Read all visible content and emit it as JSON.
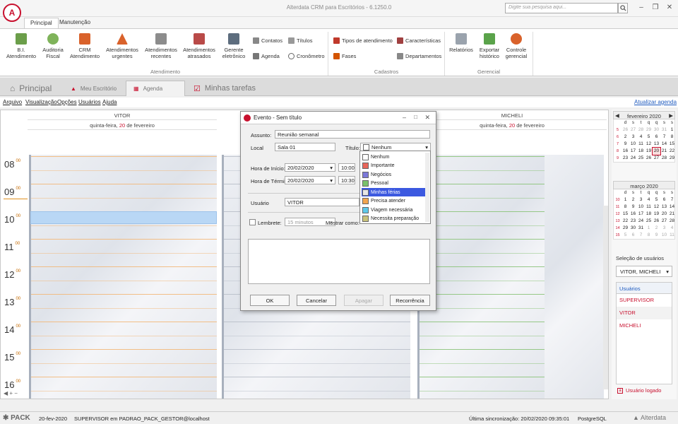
{
  "window": {
    "title": "Alterdata CRM para Escritórios - 6.1250.0",
    "search_placeholder": "Digite sua pesquisa aqui...",
    "logo_letter": "A"
  },
  "ribbon_tabs": [
    "Principal",
    "Manutenção"
  ],
  "ribbon": {
    "atendimento_buttons": [
      {
        "label": "B.I.\nAtendimento",
        "icon": "bi-icon"
      },
      {
        "label": "Auditoria\nFiscal",
        "icon": "audit-icon"
      },
      {
        "label": "CRM\nAtendimento",
        "icon": "crm-icon"
      },
      {
        "label": "Atendimentos\nurgentes",
        "icon": "urgent-icon"
      },
      {
        "label": "Atendimentos\nrecentes",
        "icon": "recent-icon"
      },
      {
        "label": "Atendimentos\natrasados",
        "icon": "late-icon"
      },
      {
        "label": "Gerente\neletrônico",
        "icon": "manager-icon"
      }
    ],
    "small_items": [
      "Contatos",
      "Agenda",
      "Títulos",
      "Cronômetro"
    ],
    "cadastros_items": [
      "Tipos de atendimento",
      "Fases",
      "Características",
      "Departamentos"
    ],
    "gerencial_buttons": [
      "Relatórios",
      "Exportar\nhistórico",
      "Controle\ngerencial"
    ],
    "groups": {
      "atendimento": "Atendimento",
      "cadastros": "Cadastros",
      "gerencial": "Gerencial"
    }
  },
  "doc_tabs": [
    "Principal",
    "Meu Escritório",
    "Agenda",
    "Minhas tarefas"
  ],
  "menu": [
    "Arquivo",
    "Visualização",
    "Opções",
    "Usuários",
    "Ajuda"
  ],
  "agenda_update": "Atualizar agenda",
  "calendar": {
    "columns": [
      {
        "user": "VITOR",
        "day_prefix": "quinta-feira, ",
        "day": "20",
        "day_suffix": " de fevereiro"
      },
      {
        "user": "",
        "day_prefix": "",
        "day": "",
        "day_suffix": ""
      },
      {
        "user": "MICHELI",
        "day_prefix": "quinta-feira, ",
        "day": "20",
        "day_suffix": " de fevereiro"
      }
    ],
    "hours": [
      "08",
      "09",
      "10",
      "11",
      "12",
      "13",
      "14",
      "15",
      "16"
    ],
    "minutes": "00"
  },
  "mini_calendars": [
    {
      "title": "fevereiro 2020",
      "weekdays": [
        "d",
        "s",
        "t",
        "q",
        "q",
        "s",
        "s"
      ],
      "weeks": [
        {
          "wk": "5",
          "days": [
            "26",
            "27",
            "28",
            "29",
            "30",
            "31",
            "1"
          ]
        },
        {
          "wk": "6",
          "days": [
            "2",
            "3",
            "4",
            "5",
            "6",
            "7",
            "8"
          ]
        },
        {
          "wk": "7",
          "days": [
            "9",
            "10",
            "11",
            "12",
            "13",
            "14",
            "15"
          ]
        },
        {
          "wk": "8",
          "days": [
            "16",
            "17",
            "18",
            "19",
            "20",
            "21",
            "22"
          ]
        },
        {
          "wk": "9",
          "days": [
            "23",
            "24",
            "25",
            "26",
            "27",
            "28",
            "29"
          ]
        }
      ]
    },
    {
      "title": "março 2020",
      "weekdays": [
        "d",
        "s",
        "t",
        "q",
        "q",
        "s",
        "s"
      ],
      "weeks": [
        {
          "wk": "10",
          "days": [
            "1",
            "2",
            "3",
            "4",
            "5",
            "6",
            "7"
          ]
        },
        {
          "wk": "11",
          "days": [
            "8",
            "9",
            "10",
            "11",
            "12",
            "13",
            "14"
          ]
        },
        {
          "wk": "12",
          "days": [
            "15",
            "16",
            "17",
            "18",
            "19",
            "20",
            "21"
          ]
        },
        {
          "wk": "13",
          "days": [
            "22",
            "23",
            "24",
            "25",
            "26",
            "27",
            "28"
          ]
        },
        {
          "wk": "14",
          "days": [
            "29",
            "30",
            "31",
            "1",
            "2",
            "3",
            "4"
          ]
        },
        {
          "wk": "15",
          "days": [
            "5",
            "6",
            "7",
            "8",
            "9",
            "10",
            "11"
          ]
        }
      ]
    }
  ],
  "user_selection": {
    "title": "Seleção de usuários",
    "value": "VITOR, MICHELI",
    "list_header": "Usuários",
    "users": [
      "SUPERVISOR",
      "VITOR",
      "MICHELI"
    ],
    "logged_label": "Usuário logado"
  },
  "dialog": {
    "title": "Evento - Sem título",
    "assunto_label": "Assunto:",
    "assunto": "Reunião semanal",
    "local_label": "Local",
    "local": "Sala 01",
    "titulo_label": "Título:",
    "titulo": "Nenhum",
    "inicio_label": "Hora de Início:",
    "inicio_data": "20/02/2020",
    "inicio_hora": "10:00",
    "termino_label": "Hora de Término:",
    "termino_data": "20/02/2020",
    "termino_hora": "10:30",
    "usuario_label": "Usuário",
    "usuario": "VITOR",
    "lembrete_label": "Lembrete:",
    "lembrete": "15 minutos",
    "mostrar_label": "Mostrar como:",
    "buttons": [
      "OK",
      "Cancelar",
      "Apagar",
      "Recorrência"
    ]
  },
  "dropdown": {
    "items": [
      {
        "label": "Nenhum",
        "color": "#ffffff"
      },
      {
        "label": "Importante",
        "color": "#e8665a"
      },
      {
        "label": "Negócios",
        "color": "#7b78d8"
      },
      {
        "label": "Pessoal",
        "color": "#7ac26a"
      },
      {
        "label": "Minhas férias",
        "color": "#e6e6e6"
      },
      {
        "label": "Precisa atender",
        "color": "#f2a54e"
      },
      {
        "label": "Viagem necessária",
        "color": "#5fc8e8"
      },
      {
        "label": "Necessita preparação",
        "color": "#c9c27a"
      }
    ],
    "selected_index": 4
  },
  "status": {
    "brand": "PACK",
    "date": "20-fev-2020",
    "session": "SUPERVISOR em PADRAO_PACK_GESTOR@localhost",
    "sync": "Última sincronização: 20/02/2020 09:35:01",
    "db": "PostgreSQL",
    "vendor": "Alterdata"
  },
  "colors": {
    "accent": "#c8102e",
    "selected": "#3c59e0",
    "event": "#b9d7f5"
  }
}
